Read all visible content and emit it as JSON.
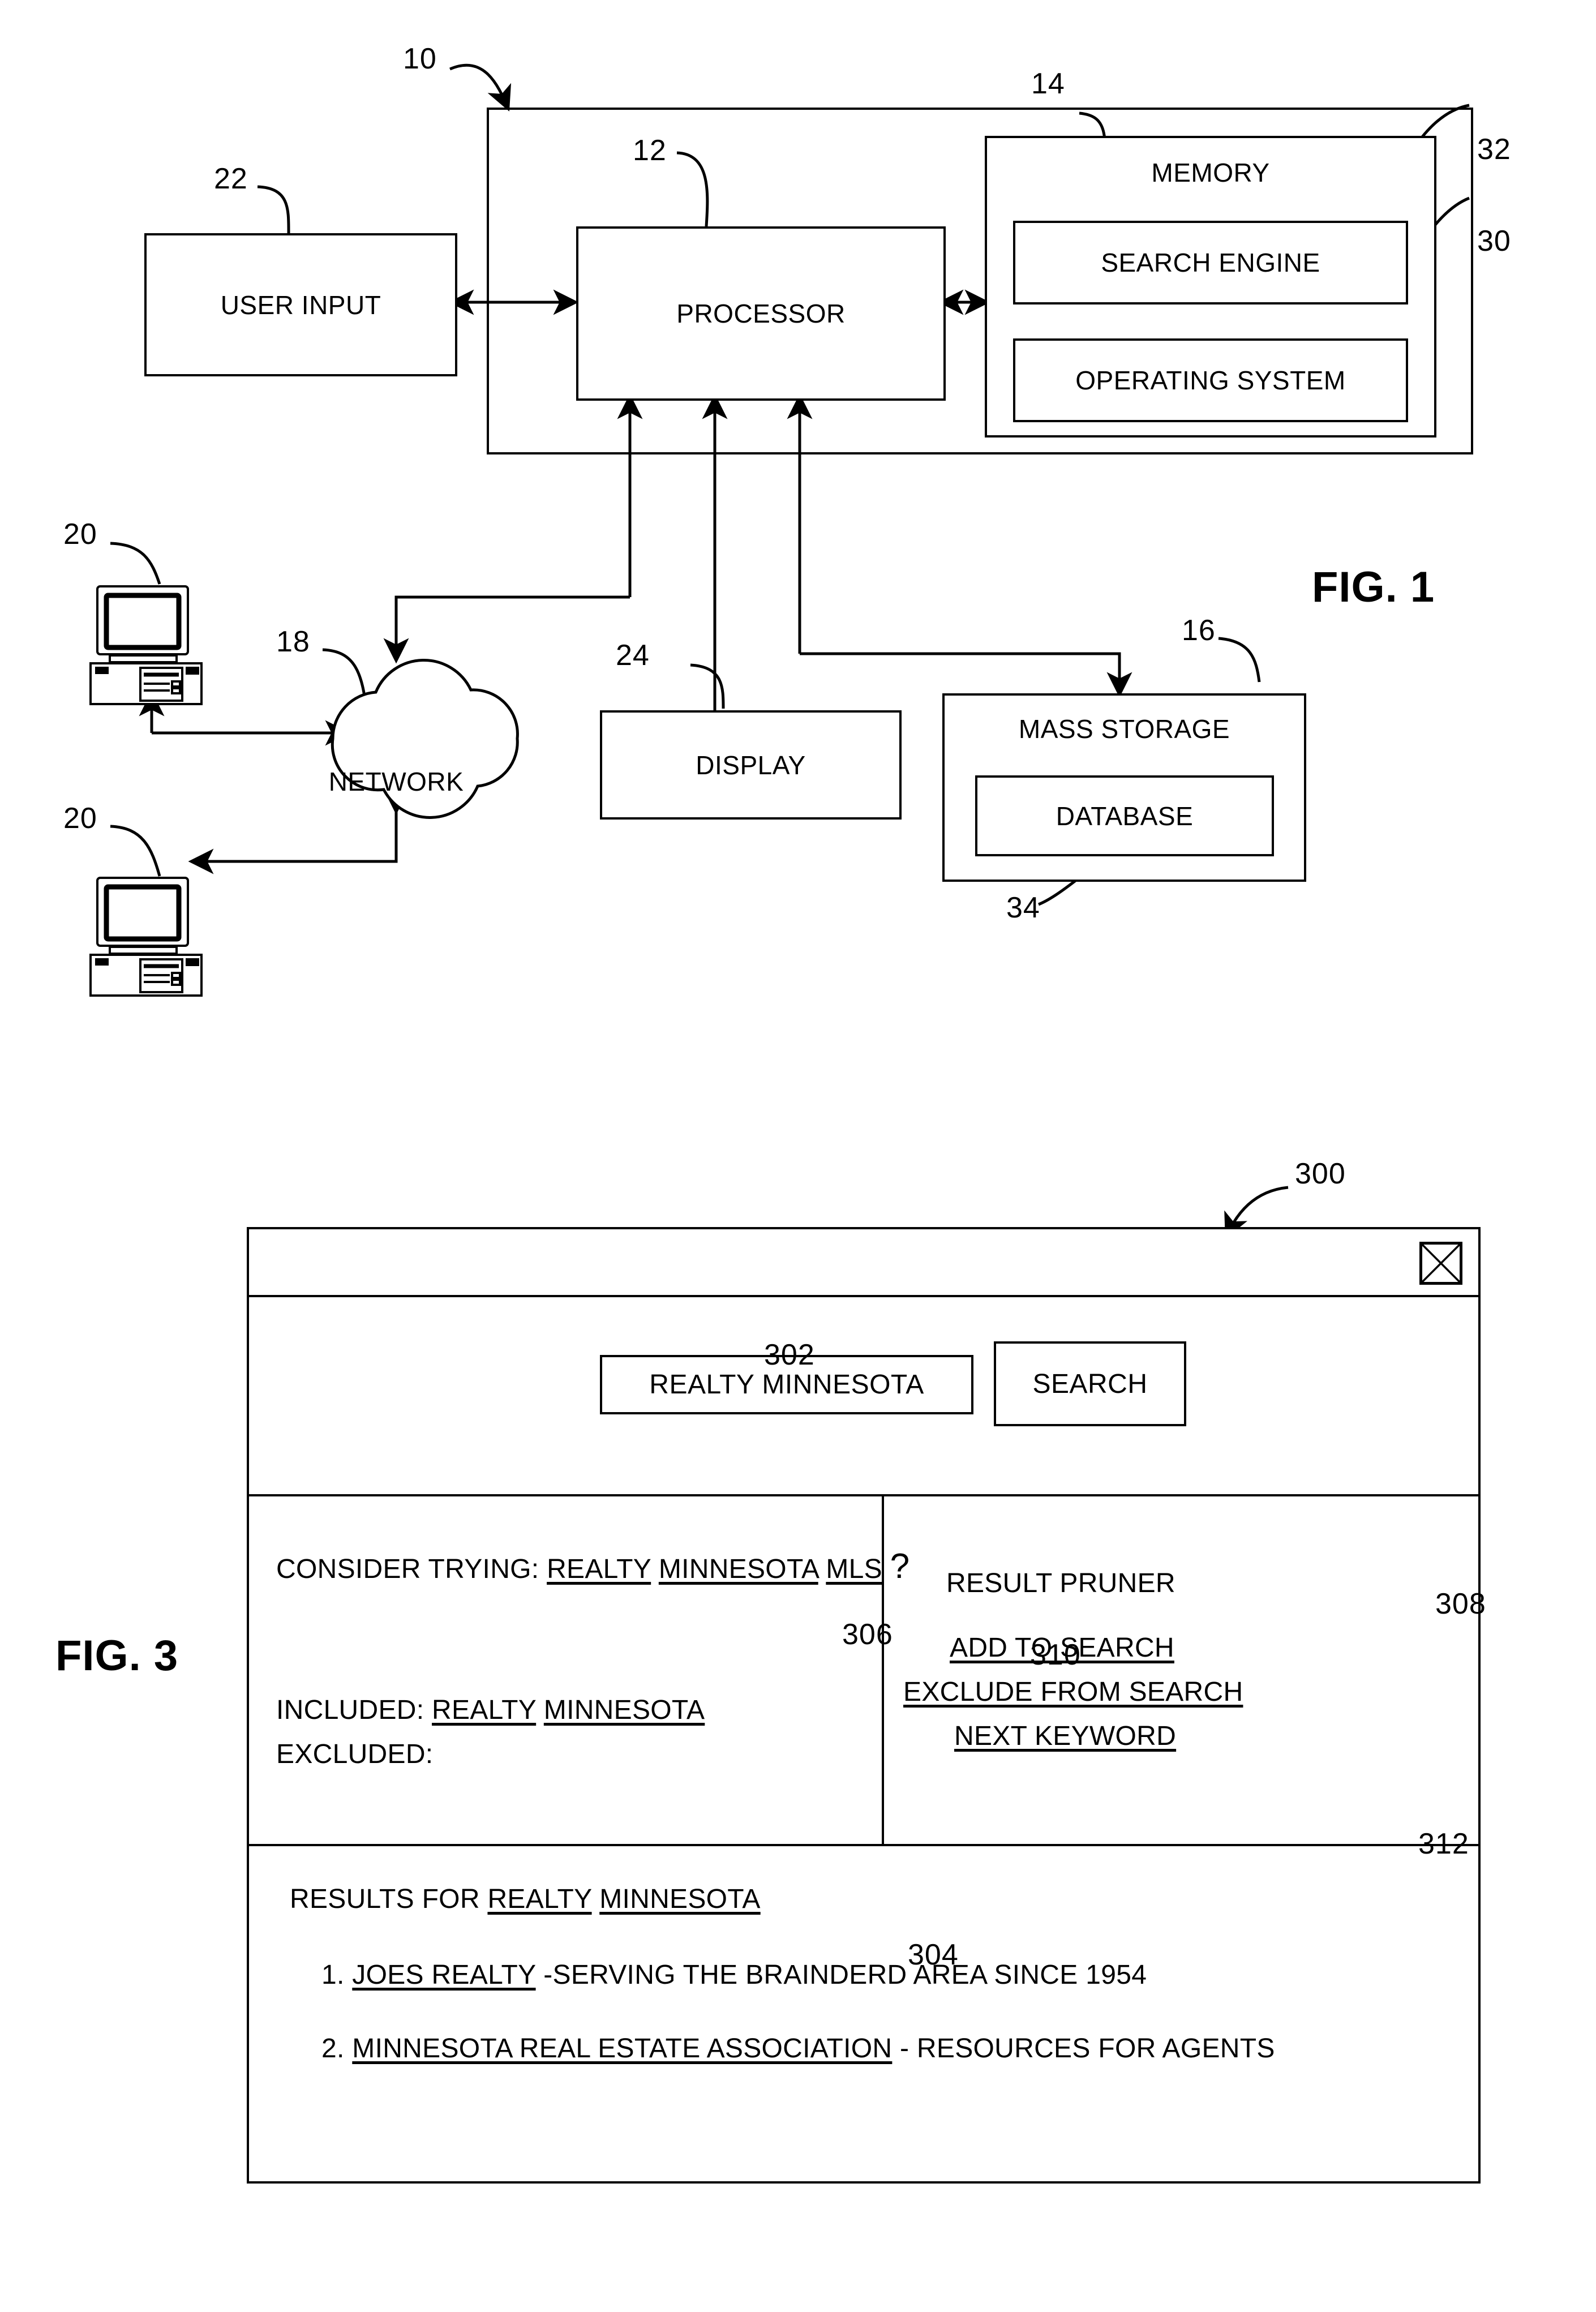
{
  "figure1": {
    "label": "FIG. 1",
    "blocks": [
      {
        "id": "user-input",
        "text": "USER INPUT",
        "ref": "22"
      },
      {
        "id": "processor",
        "text": "PROCESSOR",
        "ref": "12"
      },
      {
        "id": "memory",
        "text": "MEMORY",
        "ref": "14"
      },
      {
        "id": "search-engine",
        "text": "SEARCH ENGINE",
        "ref": "32"
      },
      {
        "id": "operating-system",
        "text": "OPERATING SYSTEM",
        "ref": "30"
      },
      {
        "id": "network",
        "text": "NETWORK",
        "ref": "18"
      },
      {
        "id": "display",
        "text": "DISPLAY",
        "ref": "24"
      },
      {
        "id": "mass-storage",
        "text": "MASS STORAGE",
        "ref": "16"
      },
      {
        "id": "database",
        "text": "DATABASE",
        "ref": "34"
      }
    ],
    "system_ref": "10",
    "client_ref_top": "20",
    "client_ref_bottom": "20",
    "refs": {
      "system": "10",
      "processor": "12",
      "memory": "14",
      "mass_storage": "16",
      "network": "18",
      "client_top": "20",
      "client_bottom": "20",
      "user_input": "22",
      "display": "24",
      "operating_system": "30",
      "search_engine": "32",
      "database": "34"
    }
  },
  "figure3": {
    "label": "FIG. 3",
    "window_ref": "300",
    "titlebar": {
      "close_icon": "close-icon"
    },
    "search": {
      "ref": "302",
      "query_value": "REALTY MINNESOTA",
      "button_label": "SEARCH"
    },
    "suggestion_panel": {
      "ref": "306",
      "prefix": "CONSIDER TRYING:",
      "terms": [
        "REALTY",
        "MINNESOTA",
        "MLS"
      ],
      "question_mark": "?",
      "included_label": "INCLUDED:",
      "included_terms": [
        "REALTY",
        "MINNESOTA"
      ],
      "excluded_label": "EXCLUDED:",
      "excluded_terms": []
    },
    "pruner_panel": {
      "title": "RESULT PRUNER",
      "title_ref": "308",
      "options": [
        {
          "label": "ADD TO SEARCH",
          "ref": "308"
        },
        {
          "label": "EXCLUDE FROM SEARCH",
          "ref": "310"
        },
        {
          "label": "NEXT KEYWORD",
          "ref": "312"
        }
      ],
      "ref_310": "310",
      "ref_312": "312"
    },
    "results_panel": {
      "ref": "304",
      "heading_prefix": "RESULTS FOR",
      "heading_terms": [
        "REALTY",
        "MINNESOTA"
      ],
      "items": [
        {
          "number": "1.",
          "link": "JOES REALTY",
          "rest": "-SERVING THE BRAINDERD AREA SINCE 1954"
        },
        {
          "number": "2.",
          "link": "MINNESOTA REAL ESTATE ASSOCIATION",
          "rest": "- RESOURCES FOR AGENTS"
        }
      ]
    }
  },
  "colors": {
    "ink": "#000000",
    "paper": "#ffffff"
  }
}
